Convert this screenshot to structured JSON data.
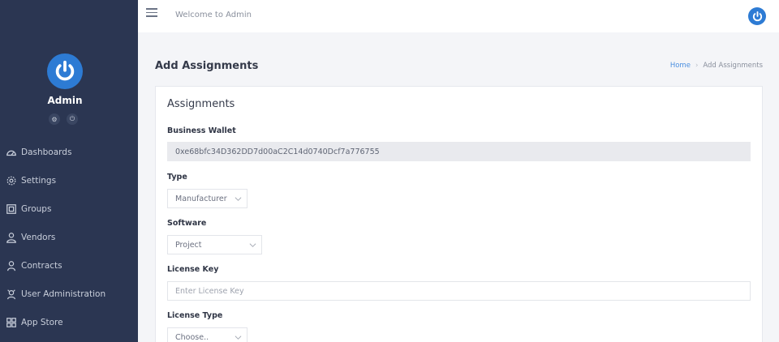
{
  "sidebar": {
    "user_name": "Admin",
    "items": [
      {
        "label": "Dashboards",
        "icon": "dashboard-icon"
      },
      {
        "label": "Settings",
        "icon": "gear-icon"
      },
      {
        "label": "Groups",
        "icon": "groups-icon"
      },
      {
        "label": "Vendors",
        "icon": "user-icon"
      },
      {
        "label": "Contracts",
        "icon": "contract-user-icon"
      },
      {
        "label": "User Administration",
        "icon": "user-admin-icon"
      },
      {
        "label": "App Store",
        "icon": "app-store-icon"
      }
    ]
  },
  "topbar": {
    "welcome": "Welcome to Admin"
  },
  "page": {
    "title": "Add Assignments"
  },
  "breadcrumb": {
    "home": "Home",
    "current": "Add Assignments"
  },
  "form": {
    "title": "Assignments",
    "business_wallet": {
      "label": "Business Wallet",
      "value": "0xe68bfc34D362DD7d00aC2C14d0740Dcf7a776755"
    },
    "type": {
      "label": "Type",
      "value": "Manufacturer"
    },
    "software": {
      "label": "Software",
      "value": "Project"
    },
    "license_key": {
      "label": "License Key",
      "placeholder": "Enter License Key"
    },
    "license_type": {
      "label": "License Type",
      "value": "Choose.."
    }
  },
  "colors": {
    "sidebar_bg": "#2b3652",
    "accent": "#2d7bd4",
    "link": "#4a8fe0"
  }
}
